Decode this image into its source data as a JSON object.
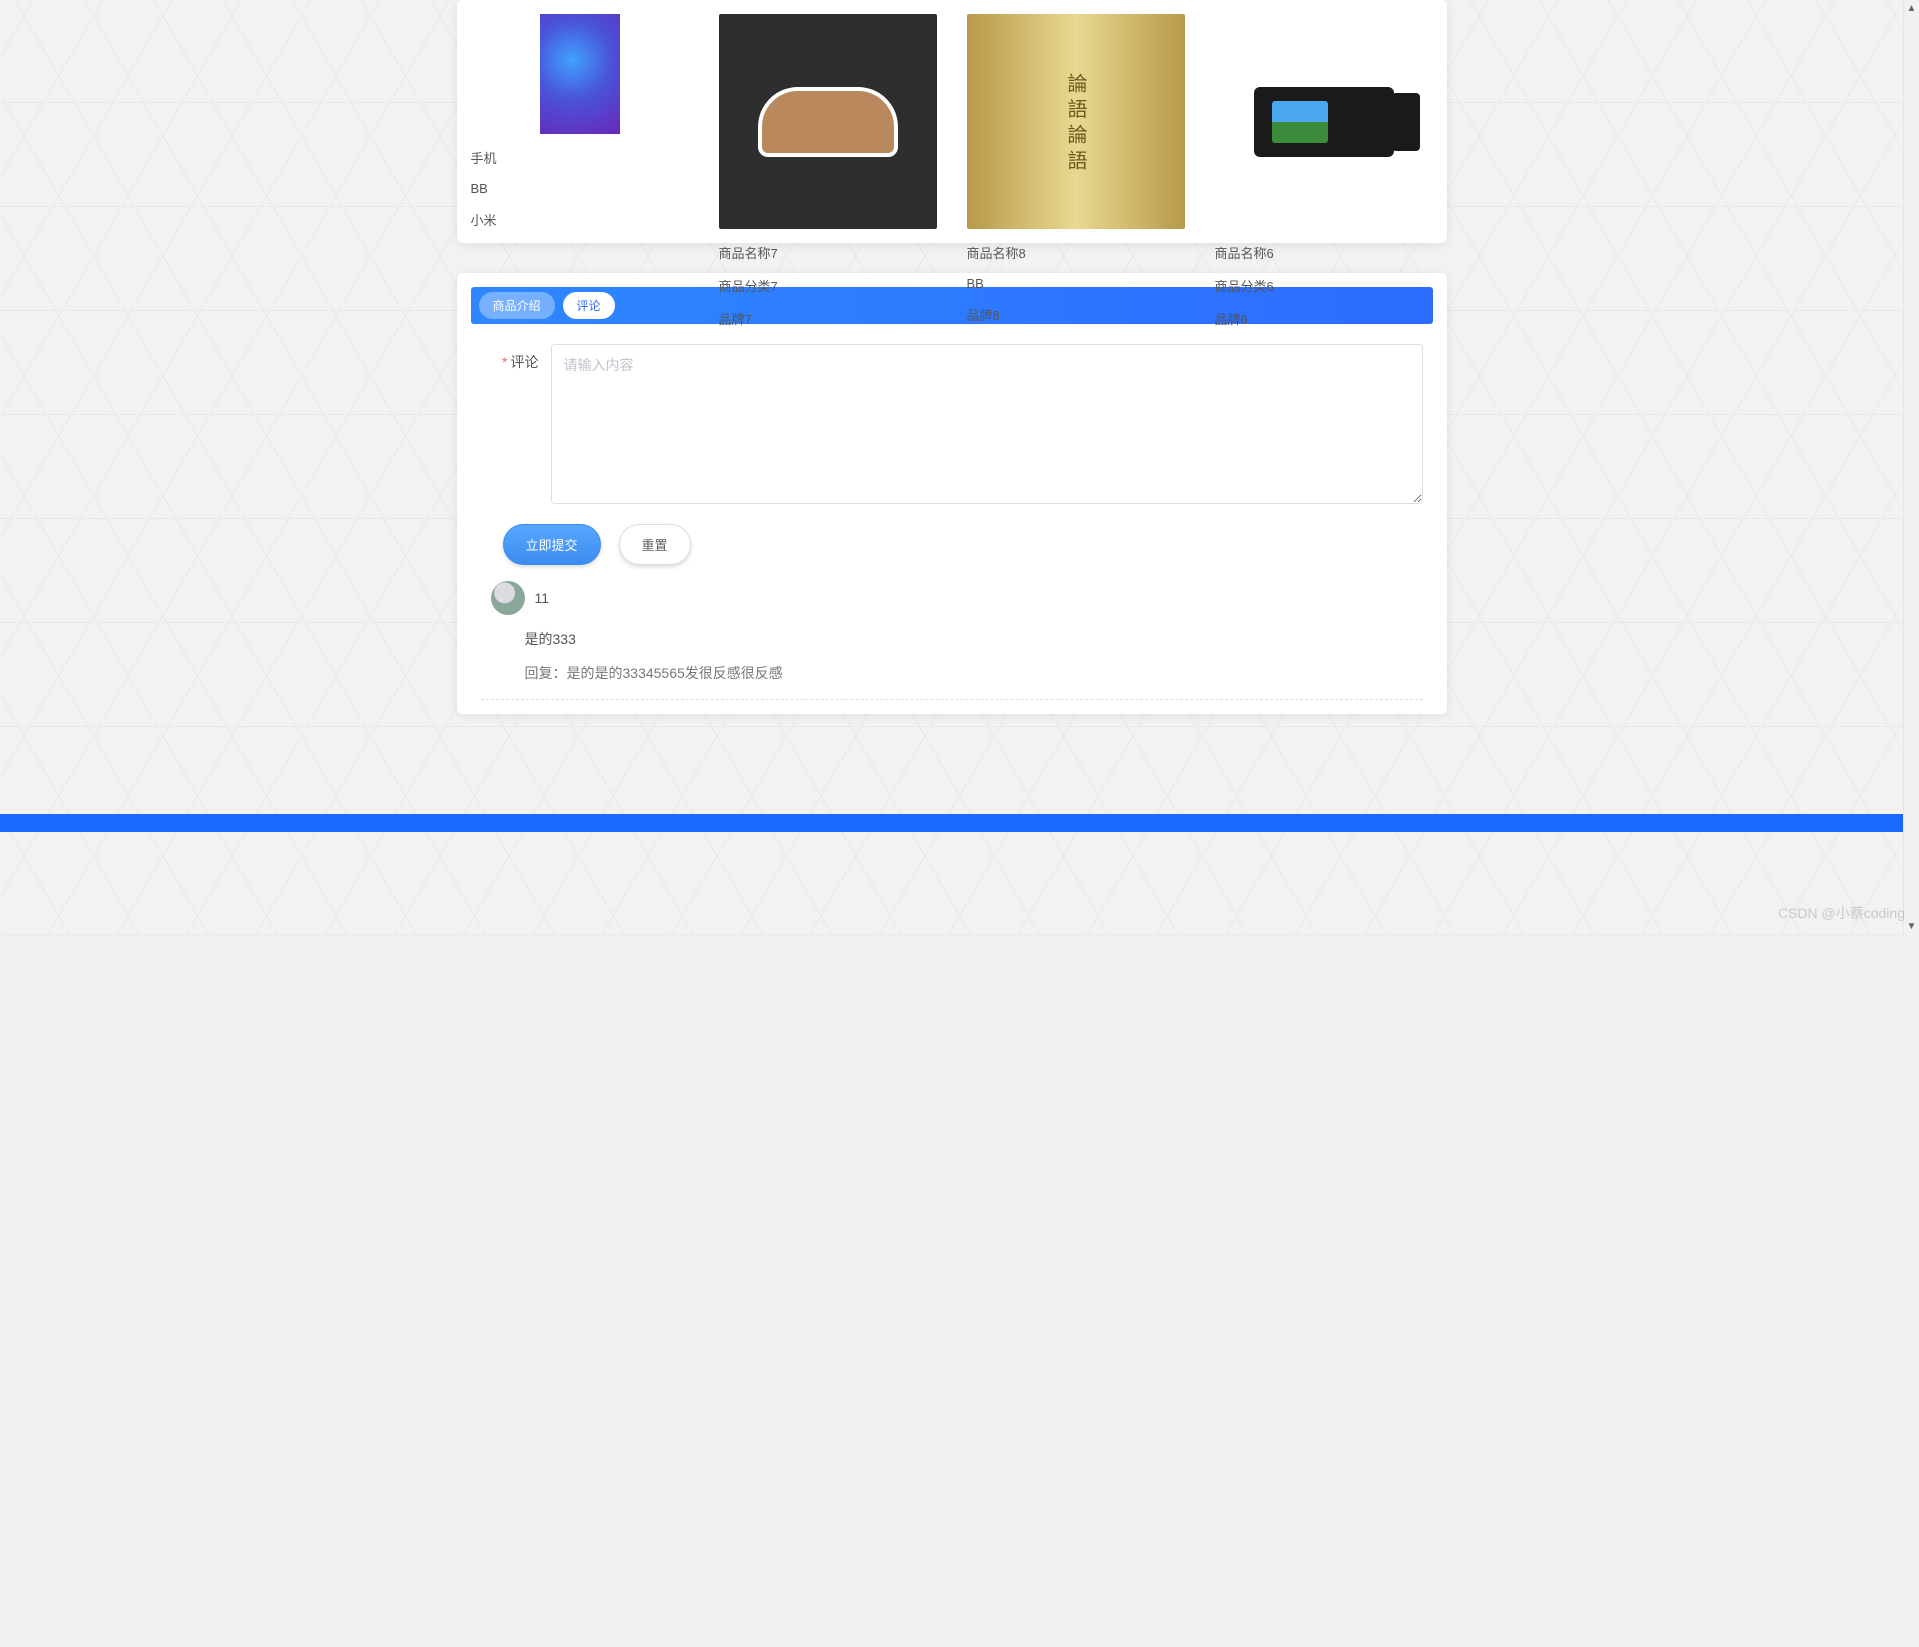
{
  "products": [
    {
      "name": "手机",
      "category": "BB",
      "brand": "小米"
    },
    {
      "name": "商品名称7",
      "category": "商品分类7",
      "brand": "品牌7"
    },
    {
      "name": "商品名称8",
      "category": "BB",
      "brand": "品牌8"
    },
    {
      "name": "商品名称6",
      "category": "商品分类6",
      "brand": "品牌6"
    }
  ],
  "tabs": {
    "intro_label": "商品介绍",
    "comments_label": "评论"
  },
  "form": {
    "label": "评论",
    "placeholder": "请输入内容",
    "submit_label": "立即提交",
    "reset_label": "重置"
  },
  "comments": [
    {
      "user": "11",
      "content": "是的333",
      "reply": "回复：是的是的33345565发很反感很反感"
    }
  ],
  "watermark": "CSDN @小蔡coding"
}
